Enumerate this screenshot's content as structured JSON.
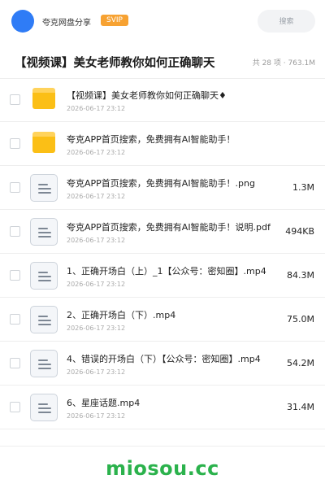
{
  "header": {
    "share_name": "夸克网盘分享",
    "badge": "SVIP",
    "search_placeholder": "搜索",
    "accent_color": "#2f7cf6",
    "badge_color": "#f7a232"
  },
  "folder": {
    "title": "【视频课】美女老师教你如何正确聊天",
    "meta": "共 28 项 · 763.1M"
  },
  "files": [
    {
      "type": "folder",
      "icon": "folder-icon",
      "name": "【视频课】美女老师教你如何正确聊天♦",
      "date": "2026-06-17 23:12",
      "size": ""
    },
    {
      "type": "folder",
      "icon": "folder-icon",
      "name": "夸克APP首页搜索，免费拥有AI智能助手！",
      "date": "2026-06-17 23:12",
      "size": ""
    },
    {
      "type": "file",
      "icon": "document-icon",
      "name": "夸克APP首页搜索，免费拥有AI智能助手！.png",
      "date": "2026-06-17 23:12",
      "size": "1.3M"
    },
    {
      "type": "file",
      "icon": "document-icon",
      "name": "夸克APP首页搜索，免费拥有AI智能助手！说明.pdf",
      "date": "2026-06-17 23:12",
      "size": "494KB"
    },
    {
      "type": "file",
      "icon": "document-icon",
      "name": "1、正确开场白（上）_1【公众号：密知圈】.mp4",
      "date": "2026-06-17 23:12",
      "size": "84.3M"
    },
    {
      "type": "file",
      "icon": "document-icon",
      "name": "2、正确开场白（下）.mp4",
      "date": "2026-06-17 23:12",
      "size": "75.0M"
    },
    {
      "type": "file",
      "icon": "document-icon",
      "name": "4、错误的开场白（下）【公众号：密知圈】.mp4",
      "date": "2026-06-17 23:12",
      "size": "54.2M"
    },
    {
      "type": "file",
      "icon": "document-icon",
      "name": "6、星座话题.mp4",
      "date": "2026-06-17 23:12",
      "size": "31.4M"
    }
  ],
  "watermark": {
    "text": "miosou.cc",
    "color": "#2bb24c"
  }
}
